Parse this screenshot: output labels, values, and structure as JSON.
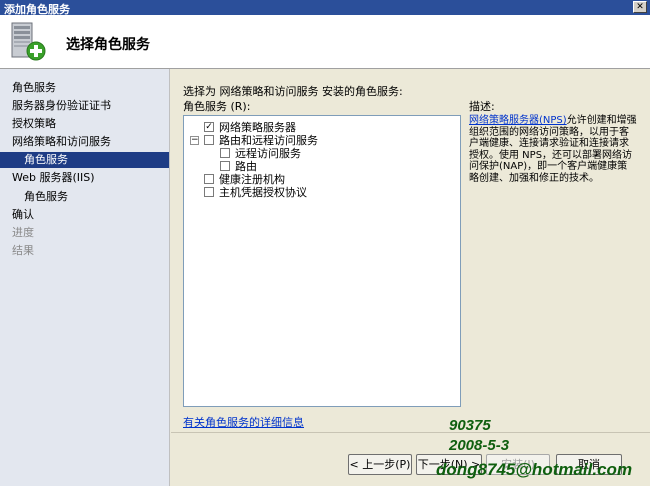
{
  "window": {
    "title": "添加角色服务",
    "close_glyph": "✕"
  },
  "header": {
    "title": "选择角色服务",
    "icon": "server-add-icon"
  },
  "sidebar": {
    "items": [
      {
        "label": "角色服务",
        "state": "normal",
        "level": 0
      },
      {
        "label": "服务器身份验证证书",
        "state": "normal",
        "level": 0
      },
      {
        "label": "授权策略",
        "state": "normal",
        "level": 0
      },
      {
        "label": "网络策略和访问服务",
        "state": "normal",
        "level": 0
      },
      {
        "label": "角色服务",
        "state": "selected",
        "level": 1
      },
      {
        "label": "Web 服务器(IIS)",
        "state": "normal",
        "level": 0
      },
      {
        "label": "角色服务",
        "state": "normal",
        "level": 1
      },
      {
        "label": "确认",
        "state": "normal",
        "level": 0
      },
      {
        "label": "进度",
        "state": "disabled",
        "level": 0
      },
      {
        "label": "结果",
        "state": "disabled",
        "level": 0
      }
    ]
  },
  "main": {
    "instruction": "选择为 网络策略和访问服务 安装的角色服务:",
    "list_label": "角色服务 (R):",
    "description_label": "描述:",
    "role_services": [
      {
        "label": "网络策略服务器",
        "checked": true,
        "level": 0,
        "expander": ""
      },
      {
        "label": "路由和远程访问服务",
        "checked": false,
        "level": 0,
        "expander": "−"
      },
      {
        "label": "远程访问服务",
        "checked": false,
        "level": 1,
        "expander": ""
      },
      {
        "label": "路由",
        "checked": false,
        "level": 1,
        "expander": ""
      },
      {
        "label": "健康注册机构",
        "checked": false,
        "level": 0,
        "expander": ""
      },
      {
        "label": "主机凭据授权协议",
        "checked": false,
        "level": 0,
        "expander": ""
      }
    ],
    "description": {
      "link_text": "网络策略服务器(NPS)",
      "text": "允许创建和增强组织范围的网络访问策略，以用于客户端健康、连接请求验证和连接请求授权。使用 NPS，还可以部署网络访问保护(NAP)，即一个客户端健康策略创建、加强和修正的技术。"
    },
    "details_link": "有关角色服务的详细信息"
  },
  "footer": {
    "back_label": "< 上一步(P)",
    "next_label": "下一步(N) >",
    "install_label": "安装(I)",
    "cancel_label": "取消"
  },
  "watermark": {
    "line1": "90375",
    "line2": "2008-5-3",
    "line3": "dong8745@hotmail.com",
    "color": "#0f5f0f"
  },
  "colors": {
    "title_bar": "#2b4f9a",
    "sidebar_bg": "#e3e7ef",
    "selected_bg": "#1e3c85",
    "link": "#0033cc",
    "window_bg": "#ece9d8"
  }
}
